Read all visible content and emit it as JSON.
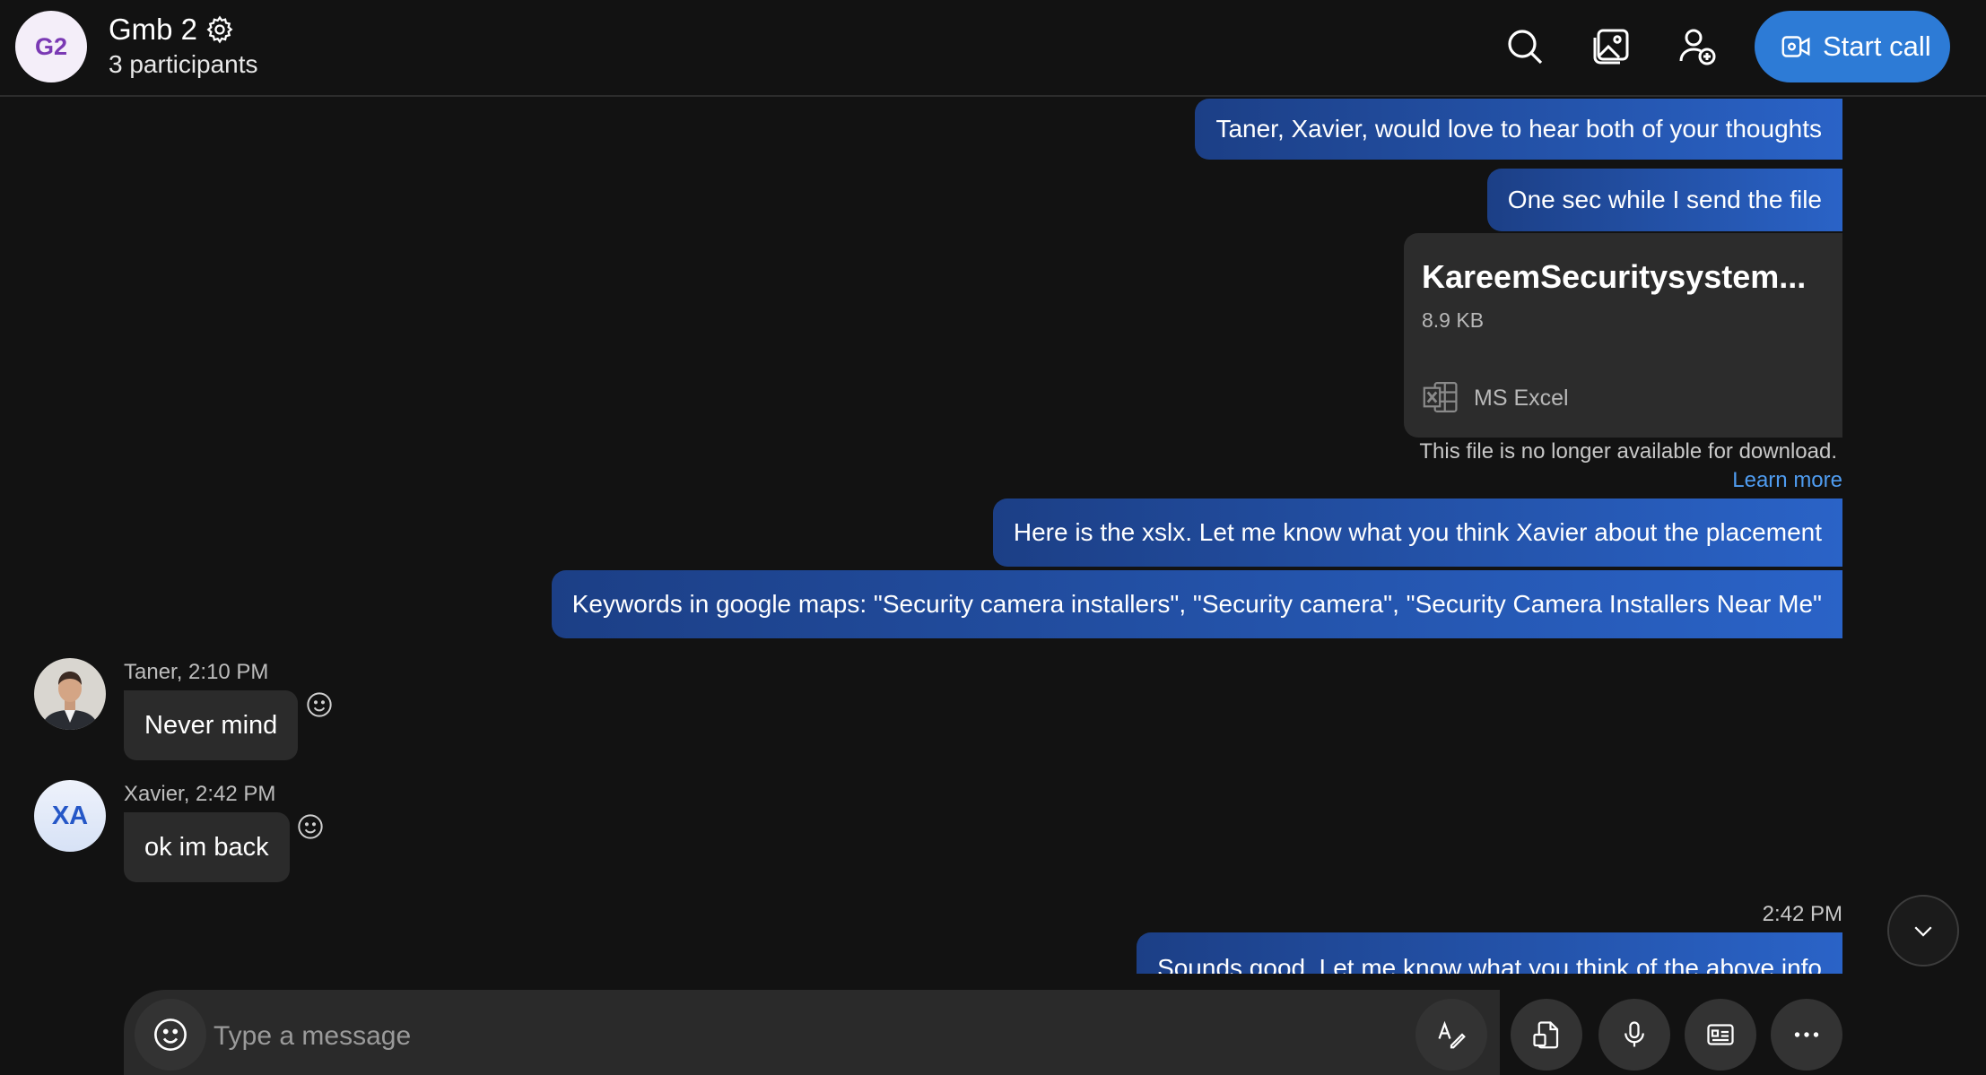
{
  "header": {
    "avatar_initials": "G2",
    "title": "Gmb 2",
    "participants": "3 participants",
    "start_call_label": "Start call",
    "icons": [
      "search-icon",
      "gallery-icon",
      "add-participant-icon",
      "video-icon"
    ]
  },
  "messages_out": [
    "Taner, Xavier, would love to hear both of your thoughts",
    "One sec while I send the file",
    "Here is the xslx. Let me know what you think Xavier about the placement",
    "Keywords in google maps: \"Security camera installers\", \"Security camera\", \"Security Camera Installers Near Me\""
  ],
  "file": {
    "name": "KareemSecuritysystem...",
    "size": "8.9 KB",
    "type": "MS Excel",
    "note": "This file is no longer available for download.",
    "learn_more": "Learn more"
  },
  "incoming": [
    {
      "sender": "Taner, 2:10 PM",
      "text": "Never mind"
    },
    {
      "sender": "Xavier, 2:42 PM",
      "text": "ok im back",
      "initials": "XA"
    }
  ],
  "last_message": {
    "time": "2:42 PM",
    "text": "Sounds good. Let me know what you think of the above info"
  },
  "composer": {
    "placeholder": "Type a message"
  },
  "colors": {
    "background": "#121212",
    "accent": "#2d7bd6",
    "bubble_out_start": "#1c3f86",
    "bubble_out_end": "#2a63c7",
    "bubble_in": "#2b2b2b"
  }
}
